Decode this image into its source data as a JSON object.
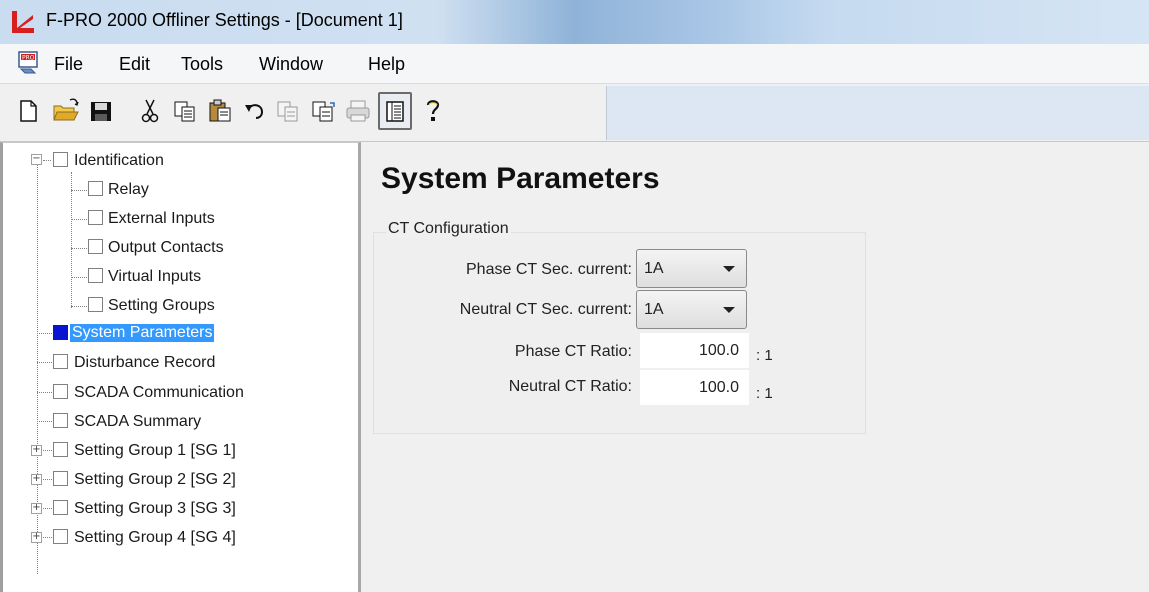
{
  "window": {
    "title": "F-PRO 2000 Offliner Settings - [Document 1]",
    "title_bar_color": "#c9dcf0"
  },
  "menu": {
    "items": [
      "File",
      "Edit",
      "Tools",
      "Window",
      "Help"
    ]
  },
  "toolbar": {
    "buttons": [
      {
        "icon": "new-document-icon",
        "enabled": true
      },
      {
        "icon": "open-folder-icon",
        "enabled": true
      },
      {
        "icon": "save-icon",
        "enabled": true
      },
      {
        "icon": "cut-icon",
        "enabled": true
      },
      {
        "icon": "copy-icon",
        "enabled": true
      },
      {
        "icon": "paste-icon",
        "enabled": true
      },
      {
        "icon": "undo-icon",
        "enabled": true
      },
      {
        "icon": "copy-settings-icon",
        "enabled": false
      },
      {
        "icon": "paste-settings-icon",
        "enabled": true
      },
      {
        "icon": "print-icon",
        "enabled": false
      },
      {
        "icon": "details-view-icon",
        "enabled": true,
        "pressed": true
      },
      {
        "icon": "help-icon",
        "enabled": true
      }
    ]
  },
  "tree": {
    "items": [
      {
        "label": "Identification",
        "level": 0,
        "expander": "minus",
        "checked": false
      },
      {
        "label": "Relay",
        "level": 1,
        "checked": false
      },
      {
        "label": "External Inputs",
        "level": 1,
        "checked": false
      },
      {
        "label": "Output Contacts",
        "level": 1,
        "checked": false
      },
      {
        "label": "Virtual Inputs",
        "level": 1,
        "checked": false
      },
      {
        "label": "Setting Groups",
        "level": 1,
        "checked": false
      },
      {
        "label": "System Parameters",
        "level": 0,
        "checked": true,
        "selected": true
      },
      {
        "label": "Disturbance Record",
        "level": 0,
        "checked": false
      },
      {
        "label": "SCADA Communication",
        "level": 0,
        "checked": false
      },
      {
        "label": "SCADA Summary",
        "level": 0,
        "checked": false
      },
      {
        "label": "Setting Group 1 [SG 1]",
        "level": 0,
        "expander": "plus",
        "checked": false
      },
      {
        "label": "Setting Group 2 [SG 2]",
        "level": 0,
        "expander": "plus",
        "checked": false
      },
      {
        "label": "Setting Group 3 [SG 3]",
        "level": 0,
        "expander": "plus",
        "checked": false
      },
      {
        "label": "Setting Group 4 [SG 4]",
        "level": 0,
        "expander": "plus",
        "checked": false
      }
    ],
    "selection_color": "#3399ff",
    "checked_color": "#0a14d0"
  },
  "content": {
    "title": "System Parameters",
    "group_title": "CT Configuration",
    "fields": {
      "phase_ct_sec_label": "Phase CT Sec. current:",
      "phase_ct_sec_value": "1A",
      "neutral_ct_sec_label": "Neutral CT Sec. current:",
      "neutral_ct_sec_value": "1A",
      "phase_ct_ratio_label": "Phase CT Ratio:",
      "phase_ct_ratio_value": "100.0",
      "neutral_ct_ratio_label": "Neutral CT Ratio:",
      "neutral_ct_ratio_value": "100.0",
      "ratio_suffix": ": 1"
    }
  }
}
